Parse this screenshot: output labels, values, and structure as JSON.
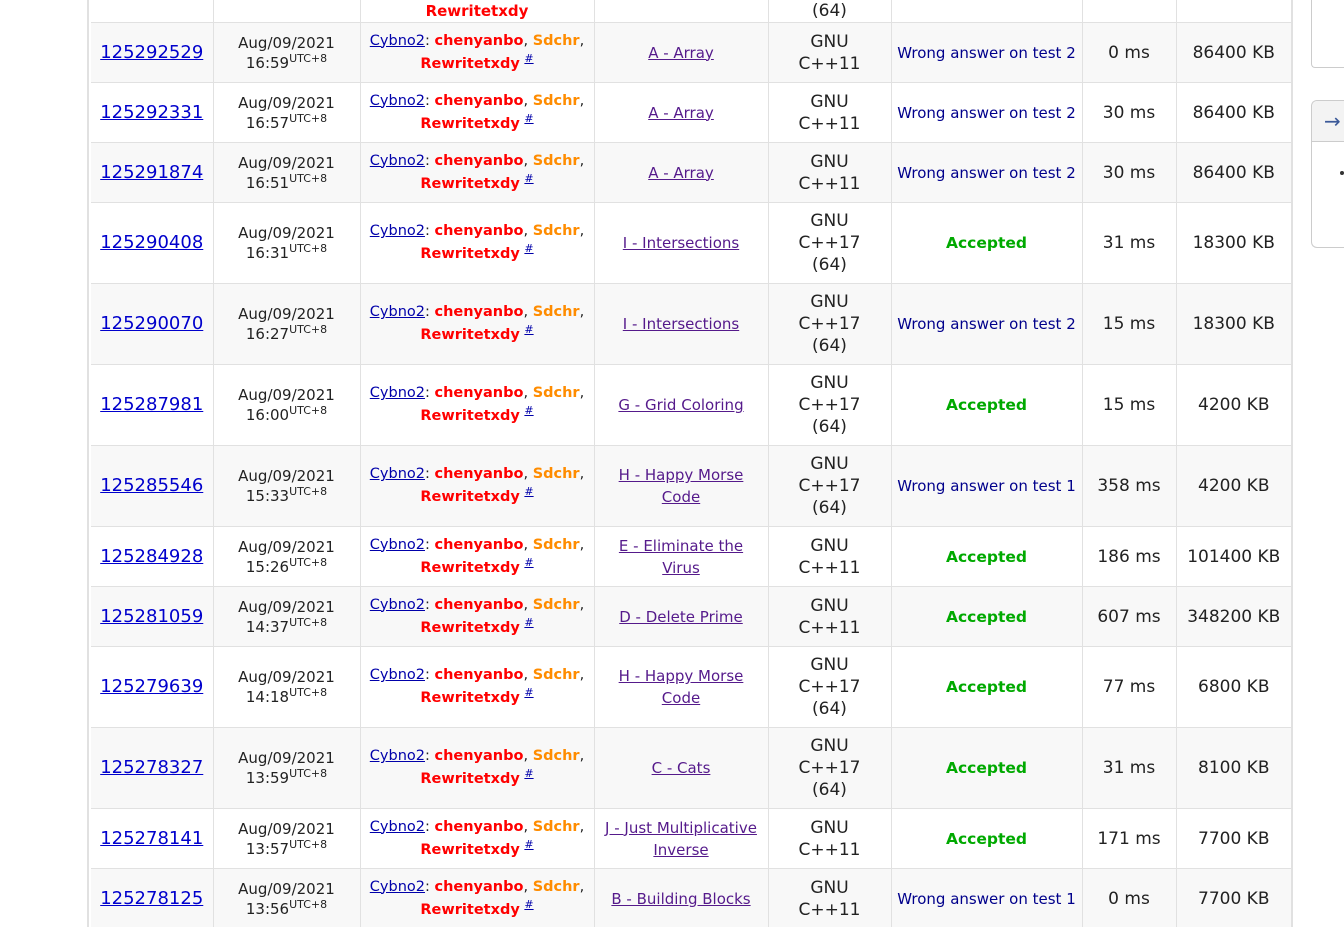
{
  "top_partial": {
    "lang": "(64)",
    "who": "Rewritetxdy"
  },
  "rows": [
    {
      "id": "125292529",
      "date": "Aug/09/2021",
      "time": "16:59",
      "tz": "UTC+8",
      "team": "Cybno2",
      "m1": "chenyanbo",
      "m2": "Sdchr",
      "m3": "Rewritetxdy",
      "hash": "#",
      "problem": "A - Array",
      "lang": [
        "GNU",
        "C++11"
      ],
      "verdict": "Wrong answer on test 2",
      "verdict_type": "wa",
      "exec": "0 ms",
      "mem": "86400 KB"
    },
    {
      "id": "125292331",
      "date": "Aug/09/2021",
      "time": "16:57",
      "tz": "UTC+8",
      "team": "Cybno2",
      "m1": "chenyanbo",
      "m2": "Sdchr",
      "m3": "Rewritetxdy",
      "hash": "#",
      "problem": "A - Array",
      "lang": [
        "GNU",
        "C++11"
      ],
      "verdict": "Wrong answer on test 2",
      "verdict_type": "wa",
      "exec": "30 ms",
      "mem": "86400 KB"
    },
    {
      "id": "125291874",
      "date": "Aug/09/2021",
      "time": "16:51",
      "tz": "UTC+8",
      "team": "Cybno2",
      "m1": "chenyanbo",
      "m2": "Sdchr",
      "m3": "Rewritetxdy",
      "hash": "#",
      "problem": "A - Array",
      "lang": [
        "GNU",
        "C++11"
      ],
      "verdict": "Wrong answer on test 2",
      "verdict_type": "wa",
      "exec": "30 ms",
      "mem": "86400 KB"
    },
    {
      "id": "125290408",
      "date": "Aug/09/2021",
      "time": "16:31",
      "tz": "UTC+8",
      "team": "Cybno2",
      "m1": "chenyanbo",
      "m2": "Sdchr",
      "m3": "Rewritetxdy",
      "hash": "#",
      "problem": "I - Intersections",
      "lang": [
        "GNU",
        "C++17",
        "(64)"
      ],
      "verdict": "Accepted",
      "verdict_type": "ac",
      "exec": "31 ms",
      "mem": "18300 KB"
    },
    {
      "id": "125290070",
      "date": "Aug/09/2021",
      "time": "16:27",
      "tz": "UTC+8",
      "team": "Cybno2",
      "m1": "chenyanbo",
      "m2": "Sdchr",
      "m3": "Rewritetxdy",
      "hash": "#",
      "problem": "I - Intersections",
      "lang": [
        "GNU",
        "C++17",
        "(64)"
      ],
      "verdict": "Wrong answer on test 2",
      "verdict_type": "wa",
      "exec": "15 ms",
      "mem": "18300 KB"
    },
    {
      "id": "125287981",
      "date": "Aug/09/2021",
      "time": "16:00",
      "tz": "UTC+8",
      "team": "Cybno2",
      "m1": "chenyanbo",
      "m2": "Sdchr",
      "m3": "Rewritetxdy",
      "hash": "#",
      "problem": "G - Grid Coloring",
      "lang": [
        "GNU",
        "C++17",
        "(64)"
      ],
      "verdict": "Accepted",
      "verdict_type": "ac",
      "exec": "15 ms",
      "mem": "4200 KB"
    },
    {
      "id": "125285546",
      "date": "Aug/09/2021",
      "time": "15:33",
      "tz": "UTC+8",
      "team": "Cybno2",
      "m1": "chenyanbo",
      "m2": "Sdchr",
      "m3": "Rewritetxdy",
      "hash": "#",
      "problem": "H - Happy Morse Code",
      "lang": [
        "GNU",
        "C++17",
        "(64)"
      ],
      "verdict": "Wrong answer on test 1",
      "verdict_type": "wa",
      "exec": "358 ms",
      "mem": "4200 KB"
    },
    {
      "id": "125284928",
      "date": "Aug/09/2021",
      "time": "15:26",
      "tz": "UTC+8",
      "team": "Cybno2",
      "m1": "chenyanbo",
      "m2": "Sdchr",
      "m3": "Rewritetxdy",
      "hash": "#",
      "problem": "E - Eliminate the Virus",
      "lang": [
        "GNU",
        "C++11"
      ],
      "verdict": "Accepted",
      "verdict_type": "ac",
      "exec": "186 ms",
      "mem": "101400 KB"
    },
    {
      "id": "125281059",
      "date": "Aug/09/2021",
      "time": "14:37",
      "tz": "UTC+8",
      "team": "Cybno2",
      "m1": "chenyanbo",
      "m2": "Sdchr",
      "m3": "Rewritetxdy",
      "hash": "#",
      "problem": "D - Delete Prime",
      "lang": [
        "GNU",
        "C++11"
      ],
      "verdict": "Accepted",
      "verdict_type": "ac",
      "exec": "607 ms",
      "mem": "348200 KB"
    },
    {
      "id": "125279639",
      "date": "Aug/09/2021",
      "time": "14:18",
      "tz": "UTC+8",
      "team": "Cybno2",
      "m1": "chenyanbo",
      "m2": "Sdchr",
      "m3": "Rewritetxdy",
      "hash": "#",
      "problem": "H - Happy Morse Code",
      "lang": [
        "GNU",
        "C++17",
        "(64)"
      ],
      "verdict": "Accepted",
      "verdict_type": "ac",
      "exec": "77 ms",
      "mem": "6800 KB"
    },
    {
      "id": "125278327",
      "date": "Aug/09/2021",
      "time": "13:59",
      "tz": "UTC+8",
      "team": "Cybno2",
      "m1": "chenyanbo",
      "m2": "Sdchr",
      "m3": "Rewritetxdy",
      "hash": "#",
      "problem": "C - Cats",
      "lang": [
        "GNU",
        "C++17",
        "(64)"
      ],
      "verdict": "Accepted",
      "verdict_type": "ac",
      "exec": "31 ms",
      "mem": "8100 KB"
    },
    {
      "id": "125278141",
      "date": "Aug/09/2021",
      "time": "13:57",
      "tz": "UTC+8",
      "team": "Cybno2",
      "m1": "chenyanbo",
      "m2": "Sdchr",
      "m3": "Rewritetxdy",
      "hash": "#",
      "problem": "J - Just Multiplicative Inverse",
      "lang": [
        "GNU",
        "C++11"
      ],
      "verdict": "Accepted",
      "verdict_type": "ac",
      "exec": "171 ms",
      "mem": "7700 KB"
    },
    {
      "id": "125278125",
      "date": "Aug/09/2021",
      "time": "13:56",
      "tz": "UTC+8",
      "team": "Cybno2",
      "m1": "chenyanbo",
      "m2": "Sdchr",
      "m3": "Rewritetxdy",
      "hash": "#",
      "problem": "B - Building Blocks",
      "lang": [
        "GNU",
        "C++11"
      ],
      "verdict": "Wrong answer on test 1",
      "verdict_type": "wa",
      "exec": "0 ms",
      "mem": "7700 KB"
    }
  ],
  "sidebar": {
    "arrow_icon": "→"
  },
  "colors": {
    "link": "#0000cc",
    "accepted": "#00a900",
    "wrong_answer": "#00008b",
    "legendary": "#ff0000",
    "master": "#ff8c00",
    "problem_link": "#551a8b"
  }
}
